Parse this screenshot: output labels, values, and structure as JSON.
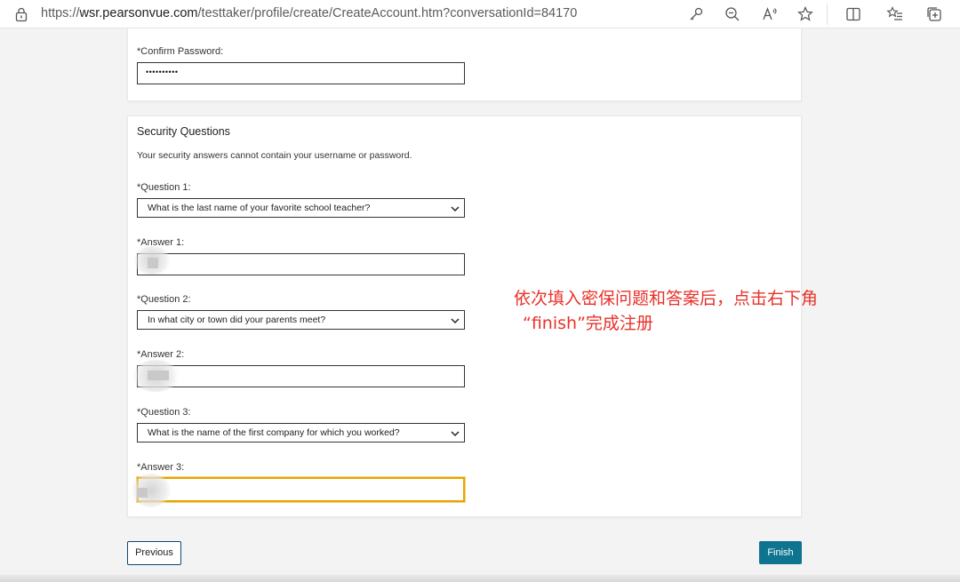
{
  "browser": {
    "url_prefix": "https://",
    "url_host": "wsr.pearsonvue.com",
    "url_path": "/testtaker/profile/create/CreateAccount.htm?conversationId=84170",
    "toolbar_icons": [
      "key-icon",
      "zoom-out-icon",
      "read-aloud-icon",
      "favorite-star-icon",
      "split-screen-icon",
      "favorites-list-icon",
      "collections-icon"
    ]
  },
  "password_section": {
    "confirm_label": "*Confirm Password:",
    "confirm_value": "••••••••••"
  },
  "security": {
    "title": "Security Questions",
    "note": "Your security answers cannot contain your username or password.",
    "q1_label": "*Question 1:",
    "q1_value": "What is the last name of your favorite school teacher?",
    "a1_label": "*Answer 1:",
    "q2_label": "*Question 2:",
    "q2_value": "In what city or town did your parents meet?",
    "a2_label": "*Answer 2:",
    "q3_label": "*Question 3:",
    "q3_value": "What is the name of the first company for which you worked?",
    "a3_label": "*Answer 3:"
  },
  "annotation": {
    "line1": "依次填入密保问题和答案后，点击右下角",
    "line2": "“finish”完成注册"
  },
  "buttons": {
    "previous": "Previous",
    "finish": "Finish"
  },
  "colors": {
    "annotation": "#e8312a",
    "finish_button": "#0e7490",
    "focus_outline": "#e6a400"
  }
}
